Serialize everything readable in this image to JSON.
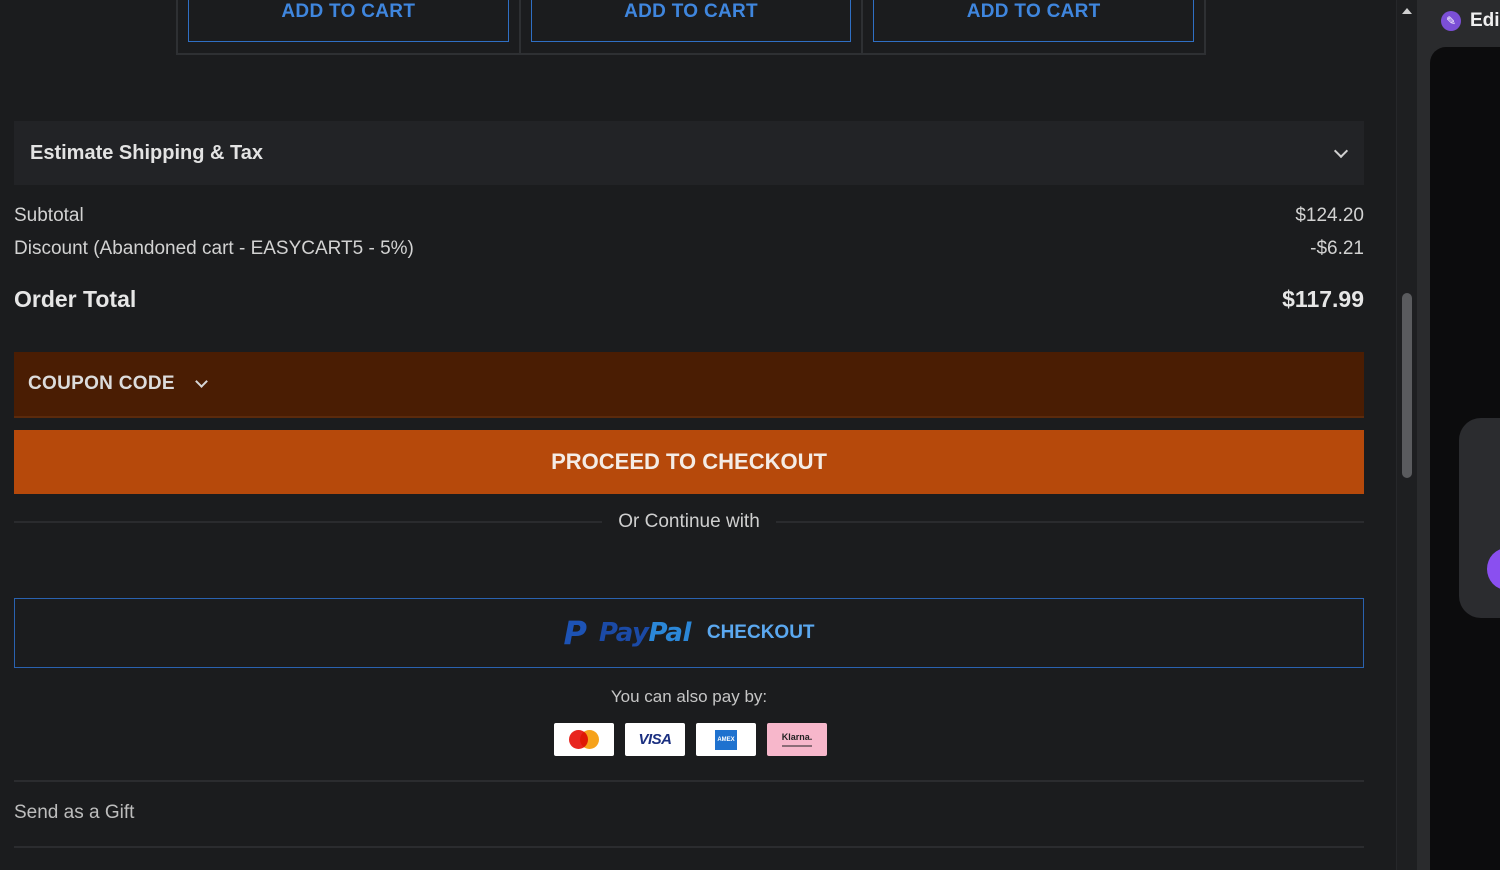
{
  "products": {
    "add_to_cart_labels": [
      "ADD TO CART",
      "ADD TO CART",
      "ADD TO CART"
    ]
  },
  "shipping": {
    "label": "Estimate Shipping & Tax",
    "icon": "chevron-down-icon"
  },
  "totals": {
    "subtotal_label": "Subtotal",
    "subtotal_value": "$124.20",
    "discount_label": "Discount (Abandoned cart - EASYCART5 - 5%)",
    "discount_value": "-$6.21",
    "order_total_label": "Order Total",
    "order_total_value": "$117.99"
  },
  "coupon": {
    "label": "COUPON CODE",
    "icon": "chevron-down-icon"
  },
  "checkout": {
    "label": "PROCEED TO CHECKOUT",
    "or_text": "Or Continue with"
  },
  "paypal": {
    "logo_pay": "Pay",
    "logo_pal": "Pal",
    "checkout_label": "CHECKOUT"
  },
  "payment_methods": {
    "label": "You can also pay by:",
    "cards": [
      "mastercard",
      "visa",
      "amex",
      "klarna"
    ],
    "visa_text": "VISA",
    "amex_text": "AMEX",
    "klarna_text": "Klarna."
  },
  "gift": {
    "label": "Send as a Gift"
  },
  "side_panel": {
    "title": "Edi"
  },
  "colors": {
    "background": "#1b1c1e",
    "accent_checkout": "#b6490b",
    "coupon_bg": "#4a1d03",
    "link_blue": "#3f86de"
  }
}
